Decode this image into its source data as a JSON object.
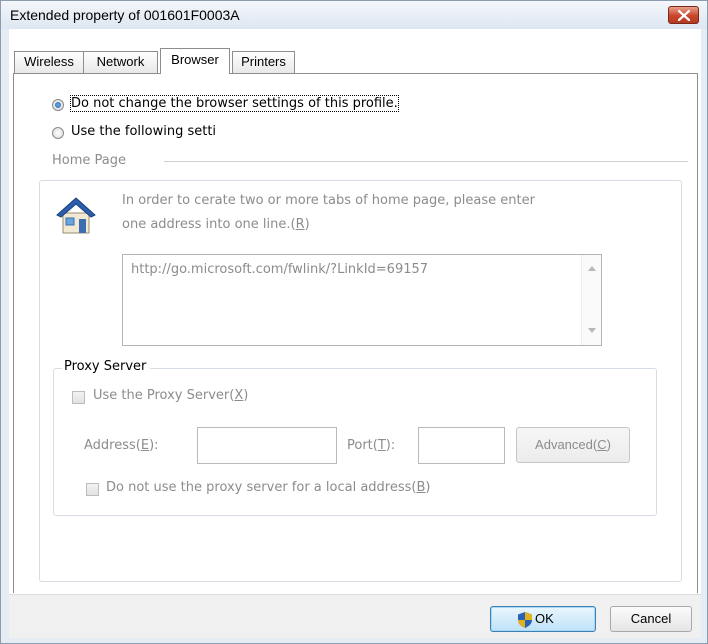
{
  "window": {
    "title": "Extended property of 001601F0003A"
  },
  "tabs": [
    {
      "label": "Wireless",
      "active": false
    },
    {
      "label": "Network",
      "active": false
    },
    {
      "label": "Browser",
      "active": true
    },
    {
      "label": "Printers",
      "active": false
    }
  ],
  "browser": {
    "radio_no_change": "Do not change the browser settings of this profile.",
    "radio_use_following": "Use the following setti",
    "selected": "radio_no_change"
  },
  "home_page": {
    "group_label": "Home Page",
    "instruction_line1": "In order to cerate two or more tabs of home page, please enter",
    "instruction_line2_prefix": "one address into one line.(",
    "instruction_line2_key": "R",
    "instruction_line2_suffix": ")",
    "url_value": "http://go.microsoft.com/fwlink/?LinkId=69157"
  },
  "proxy": {
    "group_label": "Proxy Server",
    "use_proxy_prefix": "Use the Proxy Server(",
    "use_proxy_key": "X",
    "use_proxy_suffix": ")",
    "address_prefix": "Address(",
    "address_key": "E",
    "address_suffix": "):",
    "port_prefix": "Port(",
    "port_key": "T",
    "port_suffix": "):",
    "advanced_prefix": "Advanced(",
    "advanced_key": "C",
    "advanced_suffix": ")",
    "bypass_local_prefix": "Do not use the proxy server for a local address(",
    "bypass_local_key": "B",
    "bypass_local_suffix": ")"
  },
  "buttons": {
    "ok": "OK",
    "cancel": "Cancel"
  },
  "icons": {
    "close": "close-icon",
    "home": "home-icon",
    "shield": "uac-shield-icon"
  },
  "colors": {
    "close_button": "#c8462a",
    "disabled_text": "#8c8c8c",
    "radio_dot": "#1f5fa5"
  }
}
